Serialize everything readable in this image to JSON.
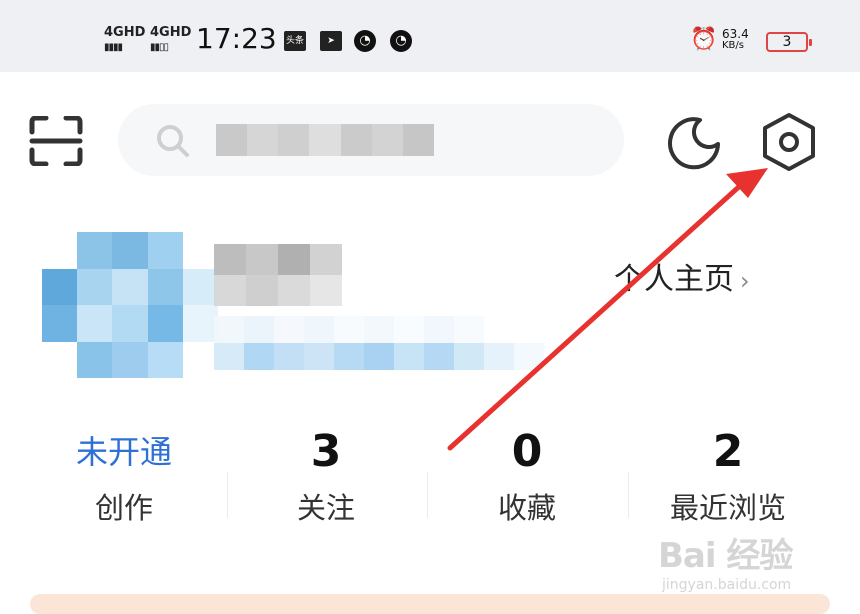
{
  "status_bar": {
    "network_1": "4GHD",
    "network_2": "4GHD",
    "time": "17:23",
    "notif_1": "头条",
    "net_speed_value": "63.4",
    "net_speed_unit": "KB/s",
    "battery_level": "3"
  },
  "header": {
    "search_placeholder_blurred": true
  },
  "profile": {
    "homepage_link": "个人主页"
  },
  "stats": [
    {
      "value": "未开通",
      "label": "创作"
    },
    {
      "value": "3",
      "label": "关注"
    },
    {
      "value": "0",
      "label": "收藏"
    },
    {
      "value": "2",
      "label": "最近浏览"
    }
  ],
  "watermark": {
    "main": "Bai 经验",
    "sub": "jingyan.baidu.com"
  },
  "colors": {
    "accent_blue": "#2e71d6",
    "annotation_red": "#e8322f",
    "status_bar_bg": "#eef0f3"
  }
}
